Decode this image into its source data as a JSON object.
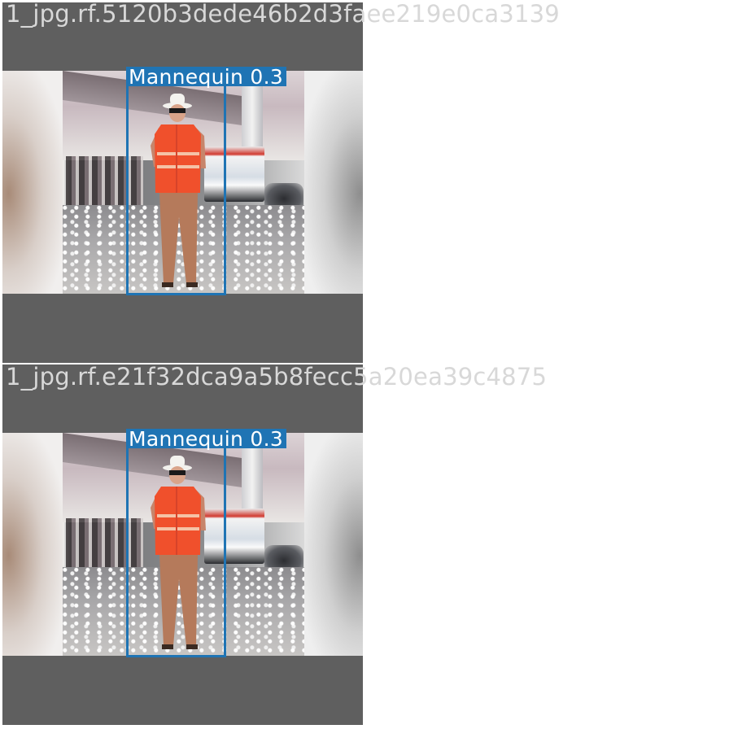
{
  "tiles": [
    {
      "filename": "1_jpg.rf.5120b3dede46b2d3faee219e0ca3139",
      "detection": {
        "label": "Mannequin",
        "confidence": "0.3"
      },
      "colors": {
        "box": "#1f74b4",
        "tile_background": "#5f5f5f"
      }
    },
    {
      "filename": "1_jpg.rf.e21f32dca9a5b8fecc5a20ea39c4875",
      "detection": {
        "label": "Mannequin",
        "confidence": "0.3"
      },
      "colors": {
        "box": "#1f74b4",
        "tile_background": "#5f5f5f"
      }
    }
  ]
}
